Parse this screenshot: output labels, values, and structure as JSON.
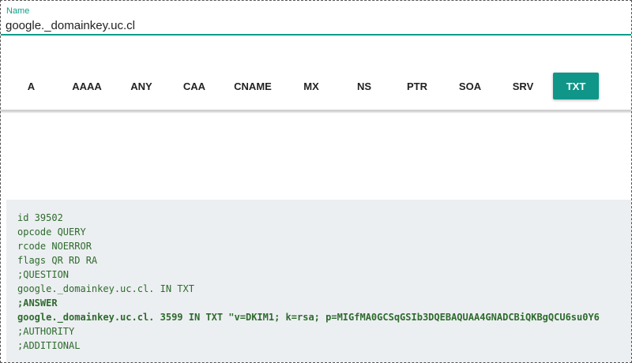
{
  "name_field": {
    "label": "Name",
    "value": "google._domainkey.uc.cl"
  },
  "record_types": {
    "items": [
      "A",
      "AAAA",
      "ANY",
      "CAA",
      "CNAME",
      "MX",
      "NS",
      "PTR",
      "SOA",
      "SRV",
      "TXT"
    ],
    "selected": "TXT"
  },
  "result": {
    "lines": [
      "id 39502",
      "opcode QUERY",
      "rcode NOERROR",
      "flags QR RD RA",
      ";QUESTION",
      "google._domainkey.uc.cl. IN TXT",
      ";ANSWER",
      "google._domainkey.uc.cl. 3599 IN TXT \"v=DKIM1; k=rsa; p=MIGfMA0GCSqGSIb3DQEBAQUAA4GNADCBiQKBgQCU6su0Y6",
      ";AUTHORITY",
      ";ADDITIONAL"
    ],
    "bold_lines": [
      6,
      7
    ]
  },
  "colors": {
    "accent": "#0f9688",
    "result_background": "#eceff1",
    "result_text": "#2e6b2e"
  }
}
